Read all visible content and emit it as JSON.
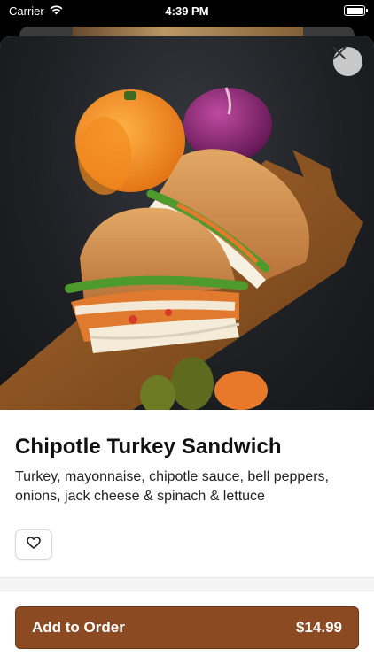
{
  "status_bar": {
    "carrier": "Carrier",
    "time": "4:39 PM"
  },
  "product": {
    "title": "Chipotle Turkey Sandwich",
    "description": "Turkey, mayonnaise, chipotle sauce, bell peppers, onions, jack cheese & spinach & lettuce",
    "image_alt": "Chipotle turkey sandwich on a wooden board with peppers and onion"
  },
  "actions": {
    "add_to_order_label": "Add to Order",
    "price": "$14.99"
  },
  "icons": {
    "close": "close-icon",
    "favorite": "heart-icon",
    "wifi": "wifi-icon",
    "battery": "battery-icon"
  },
  "colors": {
    "accent": "#8b4a22",
    "text": "#111111"
  }
}
